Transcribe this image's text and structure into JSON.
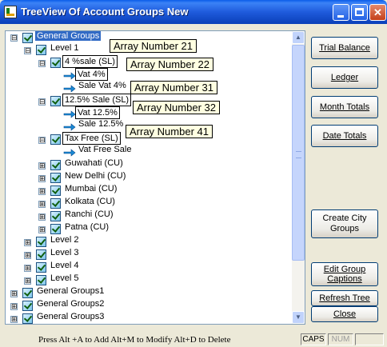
{
  "window": {
    "title": "TreeView Of Account Groups New",
    "controls": [
      "minimize",
      "maximize",
      "close"
    ]
  },
  "tree": {
    "nodes": {
      "general_groups": "General Groups",
      "level1": "Level 1",
      "sale4": "4 %sale (SL)",
      "vat4": "Vat 4%",
      "salevat4": "Sale Vat 4%",
      "sale125": "12.5% Sale (SL)",
      "vat125": "Vat 12.5%",
      "sale125b": "Sale 12.5%",
      "taxfree": "Tax Free (SL)",
      "vatfreesale": "Vat Free Sale",
      "guwahati": "Guwahati (CU)",
      "newdelhi": "New Delhi (CU)",
      "mumbai": "Mumbai (CU)",
      "kolkata": "Kolkata (CU)",
      "ranchi": "Ranchi (CU)",
      "patna": "Patna (CU)",
      "level2": "Level 2",
      "level3": "Level 3",
      "level4": "Level 4",
      "level5": "Level 5",
      "gg1": "General Groups1",
      "gg2": "General Groups2",
      "gg3": "General Groups3"
    },
    "tooltips": {
      "t21": "Array Number 21",
      "t22": "Array Number 22",
      "t31": "Array Number 31",
      "t32": "Array Number 32",
      "t41": "Array Number 41"
    },
    "expanders": {
      "expanded": "⊟",
      "collapsed": "⊞"
    },
    "icons": [
      "checkbox-icon",
      "arrow-right-icon"
    ]
  },
  "buttons": {
    "trial_balance": "Trial Balance",
    "ledger": "Ledger",
    "month_totals": "Month Totals",
    "date_totals": "Date Totals",
    "create_city_groups": "Create City Groups",
    "edit_group_captions": "Edit Group Captions",
    "refresh_tree": "Refresh Tree",
    "close": "Close"
  },
  "status": {
    "message": "Press   Alt +A to Add     Alt+M to Modify   Alt+D to Delete",
    "caps": "CAPS",
    "num": "NUM"
  },
  "colors": {
    "titlebar": "#0A5DE8",
    "selection": "#316AC5",
    "tooltip_bg": "#FFFFE1",
    "window_bg": "#ECE9D8"
  }
}
